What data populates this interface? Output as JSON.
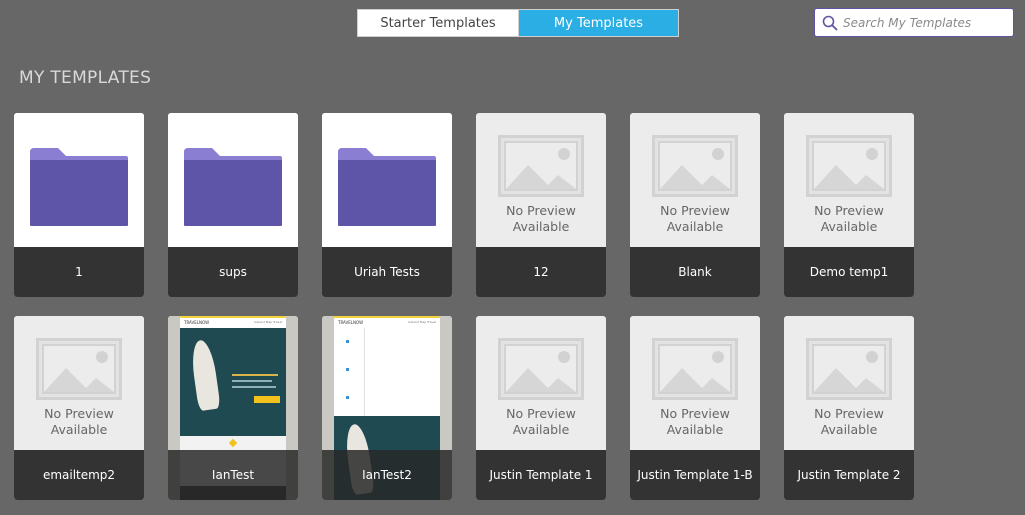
{
  "tabs": {
    "starter_label": "Starter Templates",
    "mine_label": "My Templates",
    "active": "My Templates"
  },
  "search": {
    "placeholder": "Search My Templates"
  },
  "section_title": "MY TEMPLATES",
  "no_preview": {
    "line1": "No Preview",
    "line2": "Available"
  },
  "colors": {
    "background": "#676767",
    "active_tab": "#2aaee3",
    "folder": "#5e55a8",
    "caption_bar": "#333333",
    "search_border": "#5d55a4"
  },
  "templates": [
    {
      "name": "1",
      "kind": "folder"
    },
    {
      "name": "sups",
      "kind": "folder"
    },
    {
      "name": "Uriah Tests",
      "kind": "folder"
    },
    {
      "name": "12",
      "kind": "no-preview"
    },
    {
      "name": "Blank",
      "kind": "no-preview"
    },
    {
      "name": "Demo temp1",
      "kind": "no-preview"
    },
    {
      "name": "emailtemp2",
      "kind": "no-preview"
    },
    {
      "name": "IanTest",
      "kind": "preview"
    },
    {
      "name": "IanTest2",
      "kind": "preview"
    },
    {
      "name": "Justin Template 1",
      "kind": "no-preview"
    },
    {
      "name": "Justin Template 1-B",
      "kind": "no-preview"
    },
    {
      "name": "Justin Template 2",
      "kind": "no-preview"
    }
  ],
  "preview_brand": "TRAVELNOW",
  "preview_nav": "Iceland Map Travel"
}
